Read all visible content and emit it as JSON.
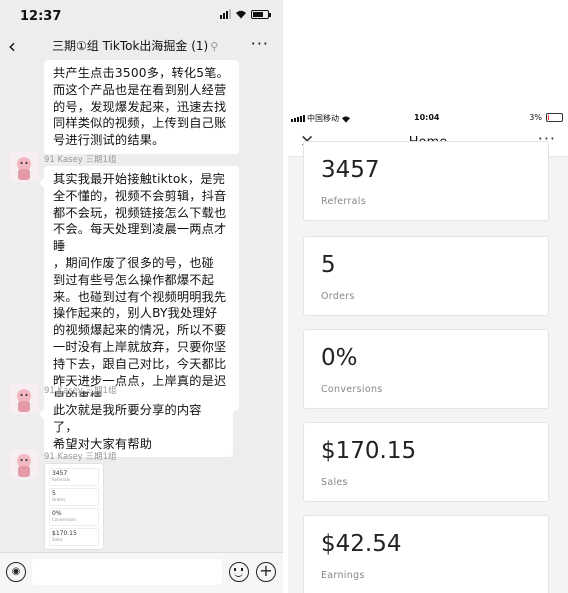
{
  "chat": {
    "status_time": "12:37",
    "title": "三期①组 TikTok出海掘金",
    "title_count": "(1)",
    "messages": [
      {
        "lines": [
          "共产生点击3500多，转化5笔。",
          "而这个产品也是在看到别人经营",
          "的号，发现爆发起来，迅速去找",
          "同样类似的视频，上传到自己账",
          "号进行测试的结果。"
        ]
      },
      {
        "sender": "91 Kasey 三期1组",
        "lines": [
          "其实我最开始接触tiktok，是完",
          "全不懂的，视频不会剪辑，抖音",
          "都不会玩，视频链接怎么下载也",
          "不会。每天处理到凌晨一两点才睡",
          "，期间作废了很多的号，也碰",
          "到过有些号怎么操作都爆不起",
          "来。也碰到过有个视频明明我先",
          "操作起来的，别人BY我处理好",
          "的视频爆起来的情况，所以不要",
          "一时没有上岸就放弃，只要你坚",
          "持下去，跟自己对比，今天都比",
          "昨天进步一点点，上岸真的是迟",
          "早的事情"
        ]
      },
      {
        "sender": "91 Kasey 三期1组",
        "lines": [
          "此次就是我所要分享的内容了，",
          "希望对大家有帮助"
        ]
      },
      {
        "sender": "91 Kasey 三期1组"
      }
    ],
    "thumb": [
      {
        "value": "3457",
        "label": "Referrals"
      },
      {
        "value": "5",
        "label": "Orders"
      },
      {
        "value": "0%",
        "label": "Conversions"
      },
      {
        "value": "$170.15",
        "label": "Sales"
      }
    ]
  },
  "app": {
    "carrier": "中国移动",
    "time": "10:04",
    "battery": "3%",
    "battery_level": 0.03,
    "title": "Home",
    "cards": [
      {
        "value": "3457",
        "label": "Referrals"
      },
      {
        "value": "5",
        "label": "Orders"
      },
      {
        "value": "0%",
        "label": "Conversions"
      },
      {
        "value": "$170.15",
        "label": "Sales"
      },
      {
        "value": "$42.54",
        "label": "Earnings"
      }
    ]
  },
  "icons": {
    "back": "back-arrow-icon",
    "more": "more-icon",
    "close": "close-icon",
    "voice": "voice-icon",
    "emoji": "emoji-icon",
    "plus": "plus-icon"
  }
}
